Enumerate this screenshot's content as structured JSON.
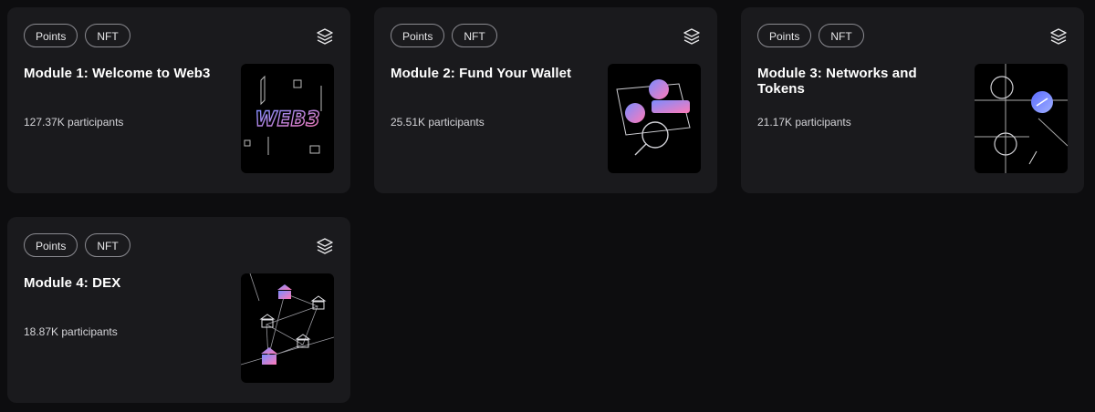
{
  "modules": [
    {
      "tags": [
        "Points",
        "NFT"
      ],
      "title": "Module 1: Welcome to Web3",
      "participants": "127.37K participants",
      "thumb_text": "WEB3"
    },
    {
      "tags": [
        "Points",
        "NFT"
      ],
      "title": "Module 2: Fund Your Wallet",
      "participants": "25.51K participants"
    },
    {
      "tags": [
        "Points",
        "NFT"
      ],
      "title": "Module 3: Networks and Tokens",
      "participants": "21.17K participants"
    },
    {
      "tags": [
        "Points",
        "NFT"
      ],
      "title": "Module 4: DEX",
      "participants": "18.87K participants"
    }
  ],
  "icons": {
    "collection": "layers-icon"
  },
  "colors": {
    "background": "#0d0d0f",
    "card": "#1a1a1d",
    "tag_border": "#8a8a90",
    "accent_gradient_start": "#7b8cff",
    "accent_gradient_end": "#ff7ab8"
  }
}
